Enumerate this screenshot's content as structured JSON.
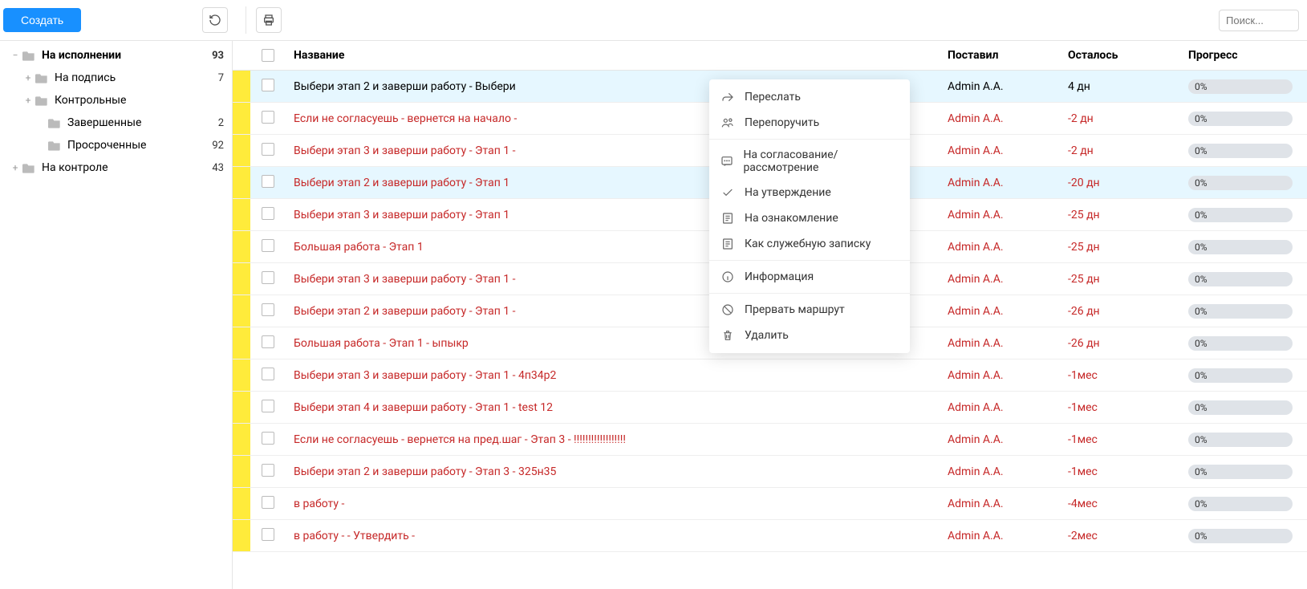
{
  "toolbar": {
    "create_label": "Создать",
    "search_placeholder": "Поиск..."
  },
  "sidebar": {
    "items": [
      {
        "label": "На исполнении",
        "count": "93",
        "indent": 0,
        "toggle": "−",
        "bold": true,
        "folder": true
      },
      {
        "label": "На подпись",
        "count": "7",
        "indent": 1,
        "toggle": "+",
        "bold": false,
        "folder": true
      },
      {
        "label": "Контрольные",
        "count": "",
        "indent": 1,
        "toggle": "+",
        "bold": false,
        "folder": true
      },
      {
        "label": "Завершенные",
        "count": "2",
        "indent": 2,
        "toggle": "",
        "bold": false,
        "folder": true
      },
      {
        "label": "Просроченные",
        "count": "92",
        "indent": 2,
        "toggle": "",
        "bold": false,
        "folder": true
      },
      {
        "label": "На контроле",
        "count": "43",
        "indent": 0,
        "toggle": "+",
        "bold": false,
        "folder": true
      }
    ]
  },
  "table": {
    "columns": {
      "name": "Название",
      "assigner": "Поставил",
      "remaining": "Осталось",
      "progress": "Прогресс"
    },
    "rows": [
      {
        "title": "Выбери этап 2 и заверши работу - Выбери",
        "assigner": "Admin A.A.",
        "remaining": "4 дн",
        "progress": "0%",
        "red": false,
        "selected": true,
        "marker": true
      },
      {
        "title": "Если не согласуешь - вернется на начало -",
        "assigner": "Admin A.A.",
        "remaining": "-2 дн",
        "progress": "0%",
        "red": true,
        "selected": false,
        "marker": true
      },
      {
        "title": "Выбери этап 3 и заверши работу - Этап 1 -",
        "assigner": "Admin A.A.",
        "remaining": "-2 дн",
        "progress": "0%",
        "red": true,
        "selected": false,
        "marker": true
      },
      {
        "title": "Выбери этап 2 и заверши работу - Этап 1",
        "assigner": "Admin A.A.",
        "remaining": "-20 дн",
        "progress": "0%",
        "red": true,
        "selected": true,
        "marker": true
      },
      {
        "title": "Выбери этап 3 и заверши работу - Этап 1",
        "assigner": "Admin A.A.",
        "remaining": "-25 дн",
        "progress": "0%",
        "red": true,
        "selected": false,
        "marker": true
      },
      {
        "title": "Большая работа - Этап 1",
        "assigner": "Admin A.A.",
        "remaining": "-25 дн",
        "progress": "0%",
        "red": true,
        "selected": false,
        "marker": true
      },
      {
        "title": "Выбери этап 3 и заверши работу - Этап 1 -",
        "assigner": "Admin A.A.",
        "remaining": "-25 дн",
        "progress": "0%",
        "red": true,
        "selected": false,
        "marker": true
      },
      {
        "title": "Выбери этап 2 и заверши работу - Этап 1 -",
        "assigner": "Admin A.A.",
        "remaining": "-26 дн",
        "progress": "0%",
        "red": true,
        "selected": false,
        "marker": true
      },
      {
        "title": "Большая работа - Этап 1 - ыпыкр",
        "assigner": "Admin A.A.",
        "remaining": "-26 дн",
        "progress": "0%",
        "red": true,
        "selected": false,
        "marker": true
      },
      {
        "title": "Выбери этап 3 и заверши работу - Этап 1 - 4п34р2",
        "assigner": "Admin A.A.",
        "remaining": "-1мес",
        "progress": "0%",
        "red": true,
        "selected": false,
        "marker": true
      },
      {
        "title": "Выбери этап 4 и заверши работу - Этап 1 - test 12",
        "assigner": "Admin A.A.",
        "remaining": "-1мес",
        "progress": "0%",
        "red": true,
        "selected": false,
        "marker": true
      },
      {
        "title": "Если не согласуешь - вернется на пред.шаг - Этап 3 - !!!!!!!!!!!!!!!!!!",
        "assigner": "Admin A.A.",
        "remaining": "-1мес",
        "progress": "0%",
        "red": true,
        "selected": false,
        "marker": true
      },
      {
        "title": "Выбери этап 2 и заверши работу - Этап 3 - 325н35",
        "assigner": "Admin A.A.",
        "remaining": "-1мес",
        "progress": "0%",
        "red": true,
        "selected": false,
        "marker": true
      },
      {
        "title": "в работу -",
        "assigner": "Admin A.A.",
        "remaining": "-4мес",
        "progress": "0%",
        "red": true,
        "selected": false,
        "marker": true
      },
      {
        "title": "в работу - - Утвердить -",
        "assigner": "Admin A.A.",
        "remaining": "-2мес",
        "progress": "0%",
        "red": true,
        "selected": false,
        "marker": true
      }
    ]
  },
  "context_menu": {
    "items": [
      {
        "label": "Переслать",
        "icon": "forward"
      },
      {
        "label": "Перепоручить",
        "icon": "reassign"
      },
      {
        "sep": true
      },
      {
        "label": "На согласование/рассмотрение",
        "icon": "review"
      },
      {
        "label": "На утверждение",
        "icon": "approve"
      },
      {
        "label": "На ознакомление",
        "icon": "inform"
      },
      {
        "label": "Как служебную записку",
        "icon": "memo"
      },
      {
        "sep": true
      },
      {
        "label": "Информация",
        "icon": "info"
      },
      {
        "sep": true
      },
      {
        "label": "Прервать маршрут",
        "icon": "stop"
      },
      {
        "label": "Удалить",
        "icon": "delete"
      }
    ]
  }
}
